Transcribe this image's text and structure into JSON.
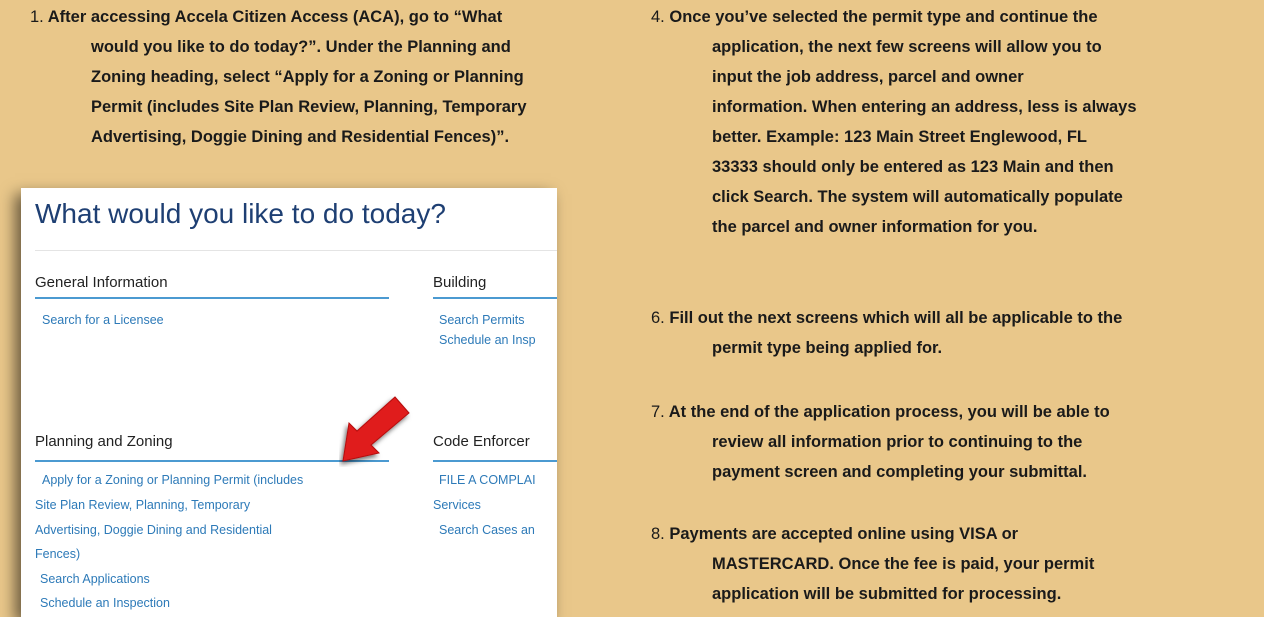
{
  "steps": {
    "s1": {
      "num": "1.",
      "first": "After accessing Accela Citizen Access (ACA), go to “What",
      "lines": [
        "would you like to do today?”.  Under the Planning and",
        "Zoning heading, select “Apply for a Zoning or Planning",
        "Permit (includes Site Plan Review, Planning, Temporary",
        "Advertising, Doggie Dining and Residential Fences)”."
      ]
    },
    "s4": {
      "num": "4.",
      "first": "Once you’ve selected the permit type and continue the",
      "lines": [
        "application, the next few screens will allow you to",
        "input the job address, parcel and owner",
        "information.  When entering an address, less is always",
        "better.  Example:  123 Main Street Englewood, FL",
        "33333 should only be entered as 123 Main and then",
        "click Search.  The system will automatically populate",
        "the parcel and owner information for you."
      ]
    },
    "s6": {
      "num": "6.",
      "first": "Fill out the next screens which will all be applicable to the",
      "lines": [
        "permit type being applied for."
      ]
    },
    "s7": {
      "num": "7.",
      "first": "At the end of the application process, you will be able to",
      "lines": [
        "review all information prior to continuing to the",
        "payment screen and completing your submittal."
      ]
    },
    "s8": {
      "num": "8.",
      "first": "Payments are accepted online using VISA or",
      "lines": [
        "MASTERCARD.  Once the fee is paid, your permit",
        "application will be submitted for processing."
      ]
    }
  },
  "screenshot": {
    "heading": "What would you like to do today?",
    "general": {
      "title": "General Information",
      "links": [
        "Search for a Licensee"
      ]
    },
    "building": {
      "title": "Building",
      "links": [
        "Search Permits",
        "Schedule an Insp"
      ]
    },
    "planning": {
      "title": "Planning and Zoning",
      "links": [
        "Apply for a Zoning or Planning Permit (includes",
        "Site Plan Review, Planning, Temporary",
        "Advertising, Doggie Dining and Residential",
        "Fences)",
        "Search Applications",
        "Schedule an Inspection"
      ]
    },
    "code": {
      "title": "Code Enforcer",
      "links": [
        "FILE A COMPLAI",
        "Services",
        "Search Cases an"
      ]
    },
    "colors": {
      "link": "#2d7ab8",
      "underline": "#4b9ad1",
      "heading": "#1e3f73",
      "arrow": "#e01b1b"
    },
    "icons": [
      "red-arrow-icon"
    ]
  }
}
